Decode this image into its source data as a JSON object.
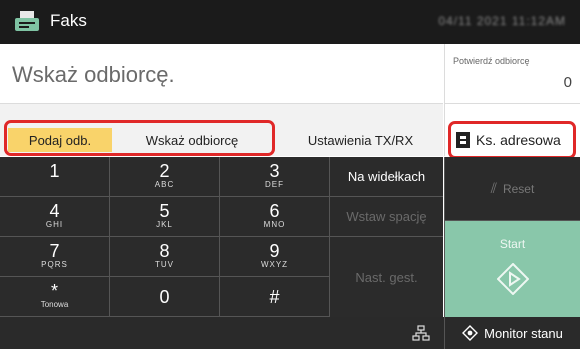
{
  "header": {
    "title": "Faks",
    "datetime": "04/11 2021 11:12AM"
  },
  "prompt": {
    "text": "Wskaż odbiorcę."
  },
  "confirm": {
    "label": "Potwierdź odbiorcę",
    "count": "0"
  },
  "tabs": {
    "enter": "Podaj odb.",
    "specify": "Wskaż odbiorcę",
    "tx_rx_settings": "Ustawienia TX/RX"
  },
  "address_book": {
    "label": "Ks. adresowa"
  },
  "keypad": [
    {
      "digit": "1",
      "letters": ""
    },
    {
      "digit": "2",
      "letters": "ABC"
    },
    {
      "digit": "3",
      "letters": "DEF"
    },
    {
      "digit": "4",
      "letters": "GHI"
    },
    {
      "digit": "5",
      "letters": "JKL"
    },
    {
      "digit": "6",
      "letters": "MNO"
    },
    {
      "digit": "7",
      "letters": "PQRS"
    },
    {
      "digit": "8",
      "letters": "TUV"
    },
    {
      "digit": "9",
      "letters": "WXYZ"
    },
    {
      "digit": "*",
      "letters": "Tonowa"
    },
    {
      "digit": "0",
      "letters": ""
    },
    {
      "digit": "#",
      "letters": ""
    }
  ],
  "side_buttons": {
    "on_hook": "Na widełkach",
    "insert_space": "Wstaw spację",
    "next_gest": "Nast. gest."
  },
  "reset": {
    "label": "Reset"
  },
  "start": {
    "label": "Start"
  },
  "status_monitor": {
    "label": "Monitor stanu"
  },
  "colors": {
    "highlight_tab": "#f9d36a",
    "start_green": "#89c7aa",
    "callout_red": "#e02828",
    "dark_panel": "#2b2b2b"
  }
}
